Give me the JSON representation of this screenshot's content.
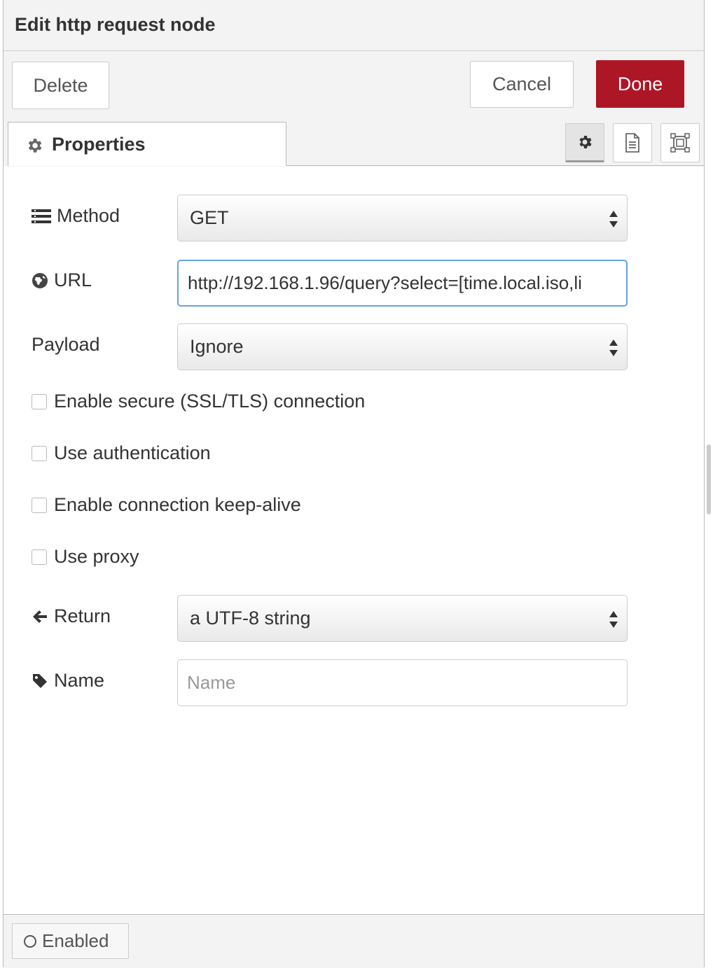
{
  "header": {
    "title": "Edit http request node"
  },
  "toolbar": {
    "delete_label": "Delete",
    "cancel_label": "Cancel",
    "done_label": "Done"
  },
  "tabs": {
    "properties_label": "Properties"
  },
  "form": {
    "method": {
      "label": "Method",
      "value": "GET"
    },
    "url": {
      "label": "URL",
      "value": "http://192.168.1.96/query?select=[time.local.iso,li"
    },
    "payload": {
      "label": "Payload",
      "value": "Ignore"
    },
    "checks": [
      {
        "label": "Enable secure (SSL/TLS) connection"
      },
      {
        "label": "Use authentication"
      },
      {
        "label": "Enable connection keep-alive"
      },
      {
        "label": "Use proxy"
      }
    ],
    "ret": {
      "label": "Return",
      "value": "a UTF-8 string"
    },
    "name": {
      "label": "Name",
      "placeholder": "Name",
      "value": ""
    }
  },
  "footer": {
    "enabled_label": "Enabled"
  },
  "colors": {
    "done_bg": "#ad1625",
    "focus_border": "#66a1e5",
    "panel_bg": "#f3f3f3"
  }
}
